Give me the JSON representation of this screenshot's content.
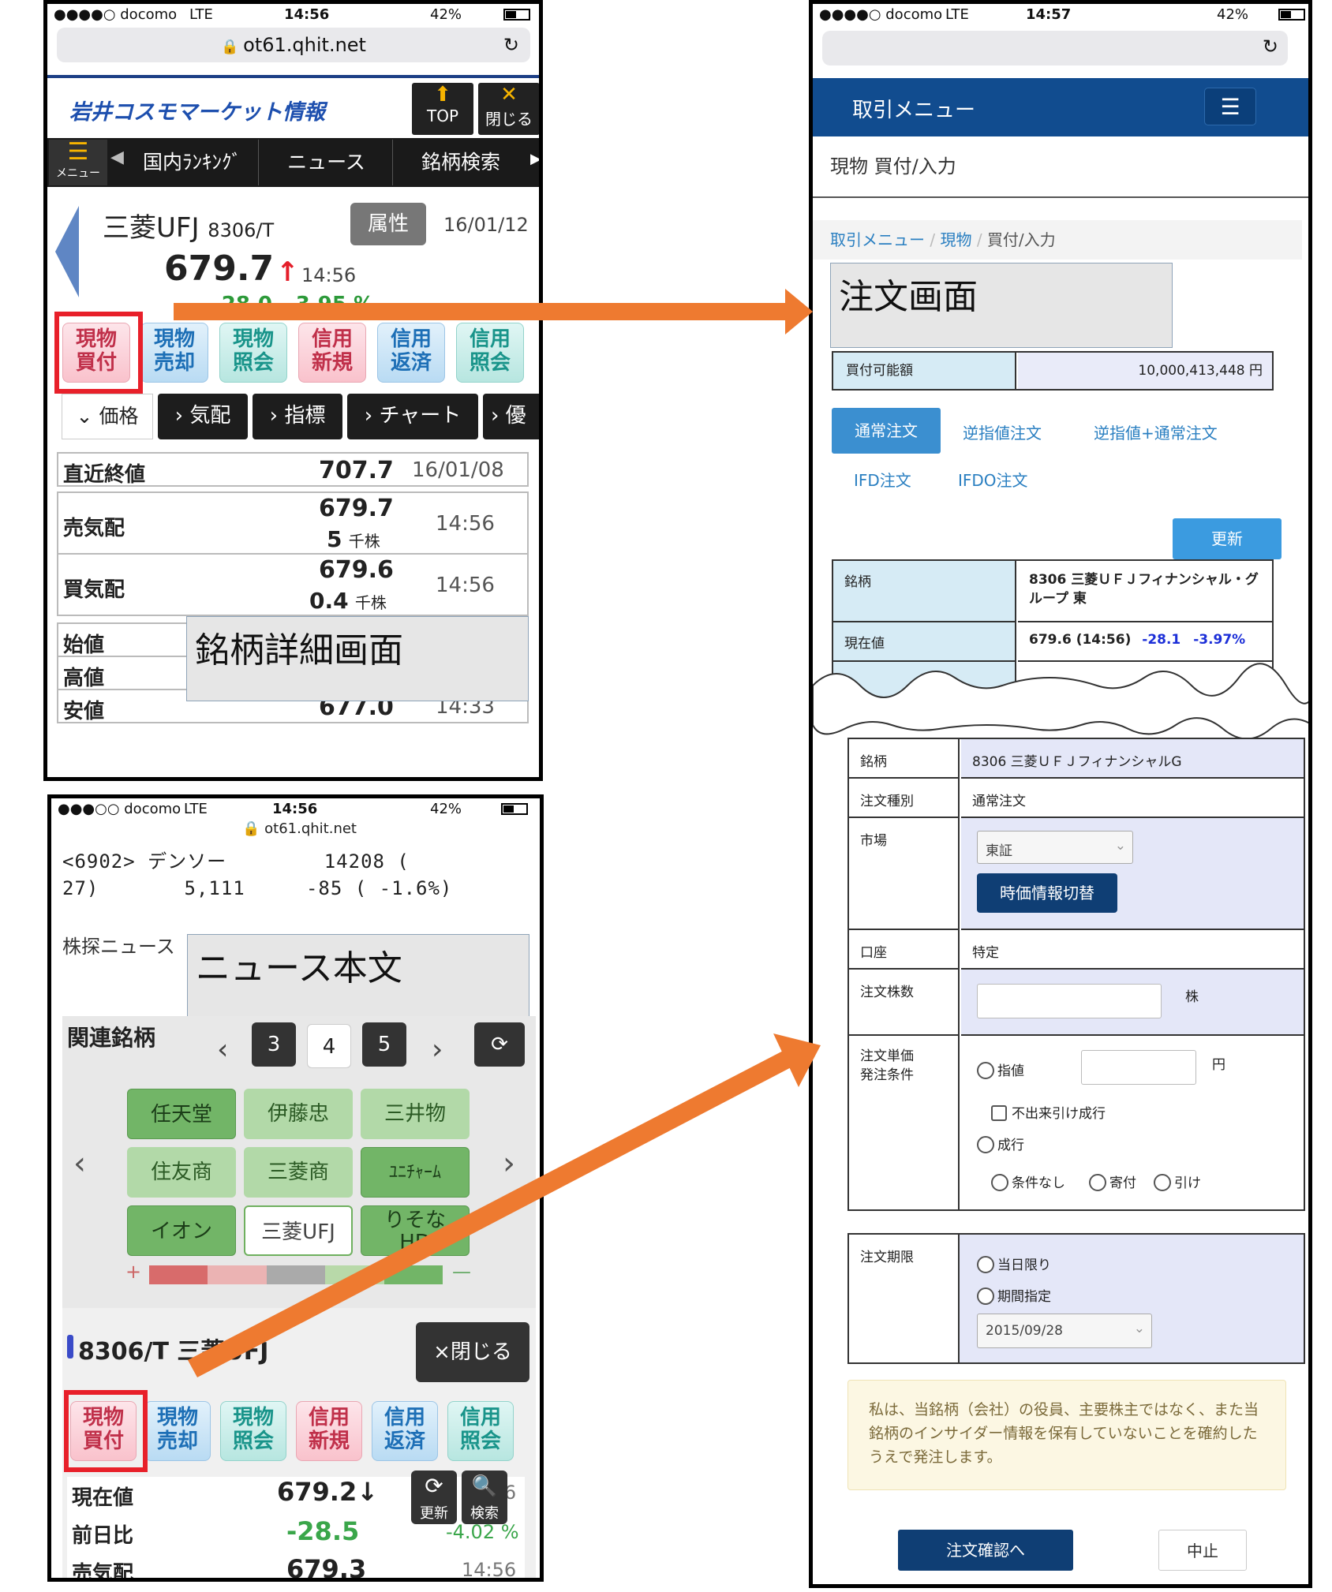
{
  "p1": {
    "status": {
      "carrier": "●●●●○ docomo",
      "net": "LTE",
      "time": "14:56",
      "battery": "42%"
    },
    "url": "ot61.qhit.net",
    "logo": "岩井コスモマーケット情報",
    "top_label": "TOP",
    "close_label": "閉じる",
    "menu_label": "メニュー",
    "nav": [
      "国内ﾗﾝｷﾝｸﾞ",
      "ニュース",
      "銘柄検索"
    ],
    "stock": {
      "name": "三菱UFJ",
      "code": "8306/T",
      "attr_btn": "属性",
      "date": "16/01/12",
      "price": "679.7",
      "time": "14:56",
      "change": "-28.0",
      "change_pct": "-3.95 %"
    },
    "trade_buttons": [
      "現物\n買付",
      "現物\n売却",
      "現物\n照会",
      "信用\n新規",
      "信用\n返済",
      "信用\n照会"
    ],
    "tabs": [
      "価格",
      "気配",
      "指標",
      "チャート",
      "優"
    ],
    "rows": [
      {
        "label": "直近終値",
        "value": "707.7",
        "extra": "16/01/08"
      },
      {
        "label": "売気配",
        "value": "679.7",
        "qty": "5",
        "unit": "千株",
        "extra": "14:56"
      },
      {
        "label": "買気配",
        "value": "679.6",
        "qty": "0.4",
        "unit": "千株",
        "extra": "14:56"
      },
      {
        "label": "始値"
      },
      {
        "label": "高値"
      },
      {
        "label": "安値",
        "value": "677.0",
        "extra": "14:33"
      }
    ],
    "overlay": "銘柄詳細画面"
  },
  "p2": {
    "status": {
      "carrier": "●●●○○ docomo",
      "net": "LTE",
      "time": "14:56",
      "battery": "42%"
    },
    "url": "ot61.qhit.net",
    "news_line1": "<6902> デンソー        14208 (",
    "news_line2": "27)       5,111     -85 ( -1.6%)",
    "news_source": "株探ニュース",
    "overlay": "ニュース本文",
    "related_title": "関連銘柄",
    "pages": [
      "3",
      "4",
      "5"
    ],
    "related": [
      "任天堂",
      "伊藤忠",
      "三井物",
      "住友商",
      "三菱商",
      "ﾕﾆﾁｬｰﾑ",
      "イオン",
      "三菱UFJ",
      "りそな\nHD"
    ],
    "plus": "+",
    "minus": "—",
    "stock_title": "8306/T 三菱UFJ",
    "close_btn": "×閉じる",
    "trade_buttons": [
      "現物\n買付",
      "現物\n売却",
      "現物\n照会",
      "信用\n新規",
      "信用\n返済",
      "信用\n照会"
    ],
    "rows": [
      {
        "label": "現在値",
        "value": "679.2↓",
        "extra": "14:56"
      },
      {
        "label": "前日比",
        "value": "-28.5",
        "extra": "-4.02 %"
      },
      {
        "label": "売気配",
        "value": "679.3",
        "extra": "14:56"
      }
    ],
    "refresh_label": "更新",
    "search_label": "検索"
  },
  "p3": {
    "status": {
      "carrier": "●●●●○ docomo",
      "net": "LTE",
      "time": "14:57",
      "battery": "42%"
    },
    "header_title": "取引メニュー",
    "page_title": "現物 買付/入力",
    "breadcrumb": [
      "取引メニュー",
      "現物",
      "買付/入力"
    ],
    "overlay": "注文画面",
    "avail_label": "買付可能額",
    "avail_value": "10,000,413,448 円",
    "order_tabs": [
      "通常注文",
      "逆指値注文",
      "逆指値+通常注文",
      "IFD注文",
      "IFDO注文"
    ],
    "update_btn": "更新",
    "info": {
      "stock_label": "銘柄",
      "stock_value": "8306 三菱ＵＦＪフィナンシャル・グループ 東",
      "price_label": "現在値",
      "price_value": "679.6 (14:56)",
      "change": "-28.1",
      "change_pct": "-3.97%"
    },
    "form": {
      "stock_label": "銘柄",
      "stock_value": "8306 三菱ＵＦＪフィナンシャルG",
      "type_label": "注文種別",
      "type_value": "通常注文",
      "market_label": "市場",
      "market_value": "東証",
      "market_btn": "時価情報切替",
      "account_label": "口座",
      "account_value": "特定",
      "qty_label": "注文株数",
      "qty_unit": "株",
      "price_label1": "注文単価",
      "price_label2": "発注条件",
      "limit": "指値",
      "yen": "円",
      "fok": "不出来引け成行",
      "market_order": "成行",
      "cond": [
        "条件なし",
        "寄付",
        "引け"
      ],
      "period_label": "注文期限",
      "today": "当日限り",
      "period": "期間指定",
      "date": "2015/09/28"
    },
    "notice": "私は、当銘柄（会社）の役員、主要株主ではなく、また当銘柄のインサイダー情報を保有していないことを確約したうえで発注します。",
    "confirm_btn": "注文確認へ",
    "cancel_btn": "中止"
  },
  "colors": {
    "arrow": "#ee7a30",
    "red_frame": "#e8202a",
    "nav_blue": "#114c8f"
  }
}
